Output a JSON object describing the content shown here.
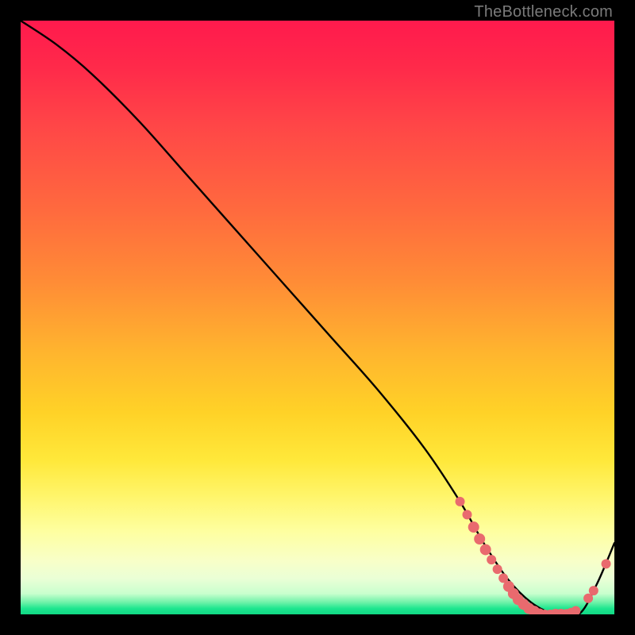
{
  "watermark": "TheBottleneck.com",
  "chart_data": {
    "type": "line",
    "title": "",
    "xlabel": "",
    "ylabel": "",
    "xlim": [
      0,
      100
    ],
    "ylim": [
      0,
      100
    ],
    "grid": false,
    "legend": false,
    "series": [
      {
        "name": "bottleneck-curve",
        "x": [
          0,
          6,
          12,
          20,
          28,
          36,
          44,
          52,
          60,
          68,
          74,
          78,
          82,
          86,
          90,
          94,
          97,
          100
        ],
        "y": [
          100,
          96,
          91,
          83,
          74,
          65,
          56,
          47,
          38,
          28,
          19,
          12,
          6,
          2,
          0,
          0,
          5,
          12
        ]
      }
    ],
    "markers": {
      "name": "highlighted-points",
      "color": "#e96a6e",
      "points": [
        {
          "x": 74.0,
          "y": 19.0,
          "r": 6
        },
        {
          "x": 75.2,
          "y": 16.8,
          "r": 6
        },
        {
          "x": 76.3,
          "y": 14.7,
          "r": 7
        },
        {
          "x": 77.3,
          "y": 12.7,
          "r": 7
        },
        {
          "x": 78.3,
          "y": 10.9,
          "r": 7
        },
        {
          "x": 79.3,
          "y": 9.2,
          "r": 6
        },
        {
          "x": 80.3,
          "y": 7.6,
          "r": 6
        },
        {
          "x": 81.3,
          "y": 6.1,
          "r": 6
        },
        {
          "x": 82.2,
          "y": 4.7,
          "r": 7
        },
        {
          "x": 83.0,
          "y": 3.5,
          "r": 7
        },
        {
          "x": 83.8,
          "y": 2.5,
          "r": 7
        },
        {
          "x": 84.7,
          "y": 1.7,
          "r": 7
        },
        {
          "x": 85.6,
          "y": 1.0,
          "r": 7
        },
        {
          "x": 86.5,
          "y": 0.5,
          "r": 7
        },
        {
          "x": 87.4,
          "y": 0.2,
          "r": 6
        },
        {
          "x": 88.3,
          "y": 0.0,
          "r": 6
        },
        {
          "x": 89.2,
          "y": 0.0,
          "r": 6
        },
        {
          "x": 90.1,
          "y": 0.0,
          "r": 7
        },
        {
          "x": 91.0,
          "y": 0.0,
          "r": 7
        },
        {
          "x": 91.9,
          "y": 0.1,
          "r": 6
        },
        {
          "x": 92.7,
          "y": 0.3,
          "r": 6
        },
        {
          "x": 93.5,
          "y": 0.6,
          "r": 6
        },
        {
          "x": 95.6,
          "y": 2.7,
          "r": 6
        },
        {
          "x": 96.5,
          "y": 4.0,
          "r": 6
        },
        {
          "x": 98.6,
          "y": 8.5,
          "r": 6
        }
      ]
    },
    "background_gradient": {
      "stops": [
        {
          "pos": 0.0,
          "color": "#ff1a4d"
        },
        {
          "pos": 0.32,
          "color": "#ff6a3e"
        },
        {
          "pos": 0.66,
          "color": "#ffd227"
        },
        {
          "pos": 0.86,
          "color": "#feffa0"
        },
        {
          "pos": 0.97,
          "color": "#6df2a8"
        },
        {
          "pos": 1.0,
          "color": "#11d884"
        }
      ]
    }
  }
}
